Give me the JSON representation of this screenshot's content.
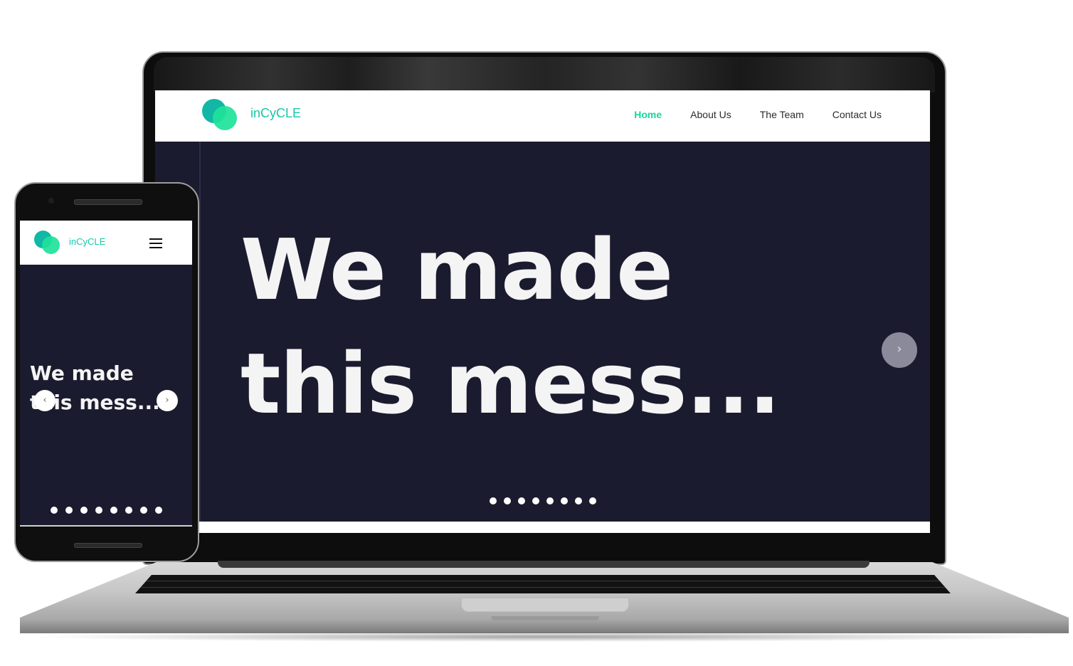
{
  "brand": {
    "name": "inCyCLE",
    "accent": "#18d79c",
    "hero_bg": "#1b1b2f"
  },
  "desktop": {
    "nav": [
      {
        "label": "Home",
        "active": true
      },
      {
        "label": "About Us",
        "active": false
      },
      {
        "label": "The Team",
        "active": false
      },
      {
        "label": "Contact Us",
        "active": false
      }
    ],
    "hero": {
      "line1": "We made",
      "line2": "this mess...",
      "next_icon": "chevron-right-icon",
      "next_glyph": "›",
      "slide_count": 8
    }
  },
  "mobile": {
    "brand_name": "inCyCLE",
    "menu_icon": "hamburger-menu-icon",
    "hero": {
      "line1": "We made",
      "line2": "this mess...",
      "prev_glyph": "‹",
      "next_glyph": "›",
      "slide_count": 8
    }
  }
}
